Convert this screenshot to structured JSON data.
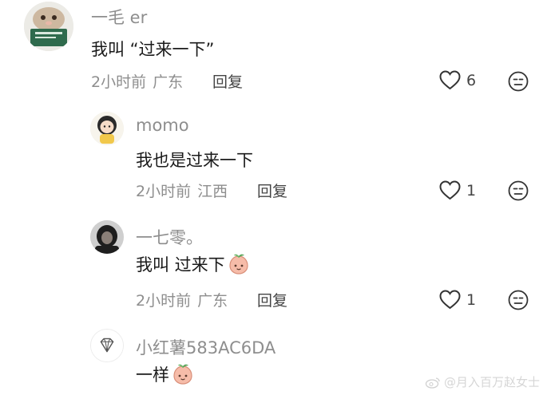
{
  "comments": [
    {
      "username": "一毛 er",
      "text": "我叫 “过来一下”",
      "time": "2小时前",
      "location": "广东",
      "reply_label": "回复",
      "likes": "6",
      "avatar": "hamster-reading-avatar"
    },
    {
      "username": "momo",
      "text": "我也是过来一下",
      "time": "2小时前",
      "location": "江西",
      "reply_label": "回复",
      "likes": "1",
      "avatar": "cartoon-girl-avatar"
    },
    {
      "username": "一七零。",
      "text": "我叫 过来下",
      "emoji": "peach-emoji",
      "time": "2小时前",
      "location": "广东",
      "reply_label": "回复",
      "likes": "1",
      "avatar": "dark-hoodie-avatar"
    },
    {
      "username": "小红薯583AC6DA",
      "text": "一样",
      "emoji": "peach-emoji",
      "avatar": "diamond-avatar"
    }
  ],
  "watermark": "@月入百万赵女士",
  "colors": {
    "muted_text": "#8e8e8e",
    "body_text": "#1a1a1a",
    "icon_stroke": "#333333",
    "peach": "#f4b6a4"
  }
}
